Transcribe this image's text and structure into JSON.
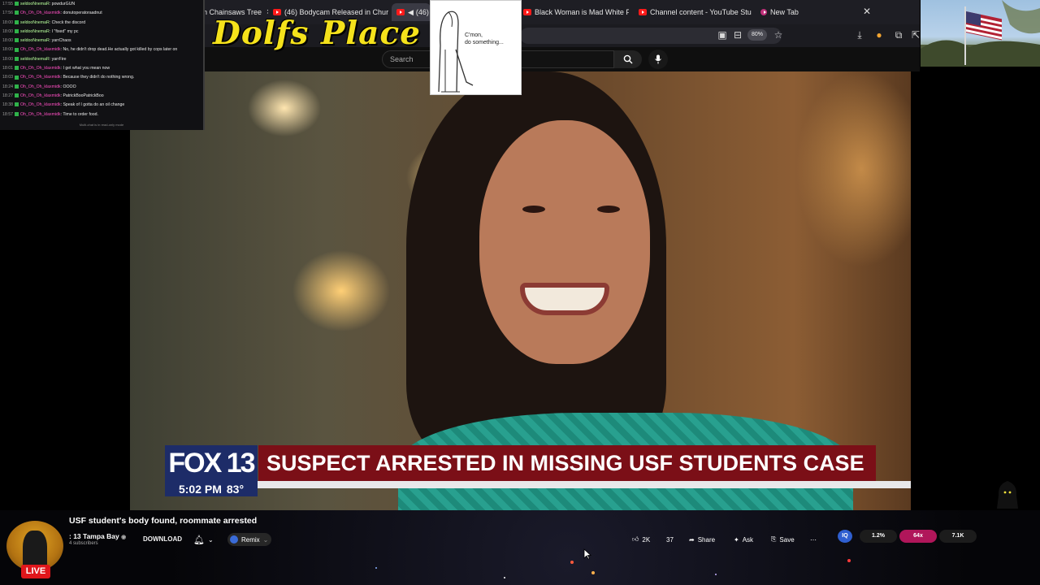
{
  "chat": {
    "lines": [
      {
        "time": "17:55",
        "user": "seldooNnemaR",
        "msg": "powdurGUN"
      },
      {
        "time": "17:56",
        "user": "Oh_Oh_Oh_klaxmidk",
        "msg": "donutoperatoraadnut"
      },
      {
        "time": "18:00",
        "user": "seldooNnemaR",
        "msg": "Check the discord"
      },
      {
        "time": "18:00",
        "user": "seldooNnemaR",
        "msg": "I \"fixed\" my pc"
      },
      {
        "time": "18:00",
        "user": "seldooNnemaR",
        "msg": "yarrChaos"
      },
      {
        "time": "18:00",
        "user": "Oh_Oh_Oh_klaxmidk",
        "msg": "No, he didn't drop dead.He actually got killed by cops later on"
      },
      {
        "time": "18:00",
        "user": "seldooNnemaR",
        "msg": "yarrFire"
      },
      {
        "time": "18:01",
        "user": "Oh_Oh_Oh_klaxmidk",
        "msg": "I get what you mean now"
      },
      {
        "time": "18:03",
        "user": "Oh_Oh_Oh_klaxmidk",
        "msg": "Because they didn't do nothing wrong."
      },
      {
        "time": "18:24",
        "user": "Oh_Oh_Oh_klaxmidk",
        "msg": "OOOO"
      },
      {
        "time": "18:27",
        "user": "Oh_Oh_Oh_klaxmidk",
        "msg": "PatrickBooPatrickBoo"
      },
      {
        "time": "18:38",
        "user": "Oh_Oh_Oh_klaxmidk",
        "msg": "Speak of I gotta do an oil change"
      },
      {
        "time": "18:57",
        "user": "Oh_Oh_Oh_klaxmidk",
        "msg": "Time to order food."
      }
    ],
    "footer": "Multi-chat is in read-only mode"
  },
  "tabs": [
    {
      "label": "n Chainsaws Tree",
      "has_close": true
    },
    {
      "label": "(46) Bodycam Released in Chur",
      "has_close": true
    },
    {
      "label": "(46)",
      "has_close": false,
      "active": true
    },
    {
      "label": "Black Woman is Mad White Peo",
      "has_close": true
    },
    {
      "label": "Channel content - YouTube Stu",
      "has_close": true
    },
    {
      "label": "New Tab",
      "has_close": false
    }
  ],
  "overlay": {
    "logo": "Dolfs Place",
    "meme_caption_1": "C'mon,",
    "meme_caption_2": "do something..."
  },
  "browser": {
    "zoom": "80%"
  },
  "youtube": {
    "search_placeholder": "Search"
  },
  "video": {
    "station": "FOX 13",
    "headline": "SUSPECT ARRESTED IN MISSING USF STUDENTS CASE",
    "time": "5:02 PM",
    "temp": "83°"
  },
  "info": {
    "title": "USF student's body found, roommate arrested",
    "channel": ": 13 Tampa Bay",
    "subscribers": "4 subscribers",
    "download": "DOWNLOAD",
    "remix": "Remix",
    "likes": "2K",
    "comments": "37",
    "share": "Share",
    "ask": "Ask",
    "save": "Save",
    "live": "LIVE"
  },
  "stream_stats": {
    "stat1": "1.2%",
    "stat2": "64x",
    "stat3": "7.1K"
  },
  "colors": {
    "fox_blue": "#1d2c68",
    "headline_red": "#7b0f17",
    "logo_yellow": "#f5e21b",
    "live_red": "#e0161b"
  }
}
